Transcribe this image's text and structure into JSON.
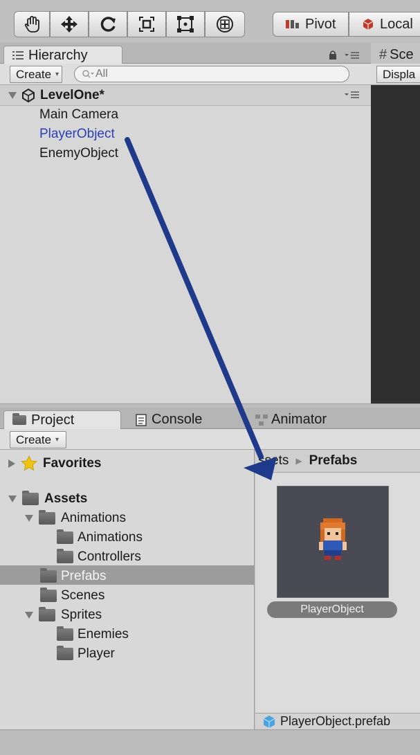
{
  "toolbar": {
    "tools": [
      "hand-tool",
      "move-tool",
      "rotate-tool",
      "scale-tool",
      "rect-tool",
      "transform-tool"
    ],
    "pivot_label": "Pivot",
    "local_label": "Local"
  },
  "hierarchy": {
    "tab_label": "Hierarchy",
    "create_label": "Create",
    "search_placeholder": "All",
    "scene_name": "LevelOne*",
    "items": [
      {
        "label": "Main Camera",
        "selected": false
      },
      {
        "label": "PlayerObject",
        "selected": true
      },
      {
        "label": "EnemyObject",
        "selected": false
      }
    ]
  },
  "scene": {
    "tab_label": "Sce",
    "display_label": "Displa"
  },
  "project": {
    "tabs": [
      "Project",
      "Console",
      "Animator"
    ],
    "create_label": "Create",
    "tree": {
      "favorites": "Favorites",
      "assets": "Assets",
      "animations": "Animations",
      "animations_child": "Animations",
      "controllers": "Controllers",
      "prefabs": "Prefabs",
      "scenes": "Scenes",
      "sprites": "Sprites",
      "enemies": "Enemies",
      "player": "Player"
    },
    "breadcrumb": {
      "root": "ssets",
      "current": "Prefabs"
    },
    "asset": {
      "name": "PlayerObject"
    },
    "status_file": "PlayerObject.prefab"
  },
  "colors": {
    "selected_text": "#2b3fb5",
    "drag_arrow": "#1f3a8a"
  }
}
